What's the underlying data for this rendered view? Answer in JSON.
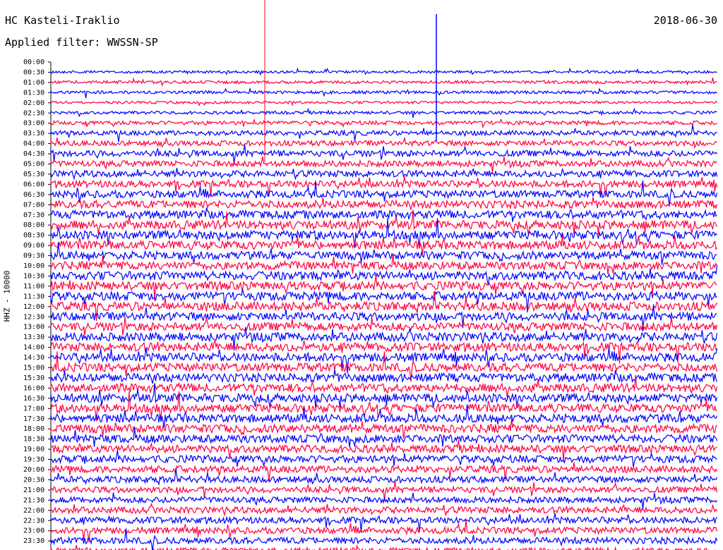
{
  "header": {
    "station": "HC Kasteli-Iraklio",
    "filter": "Applied filter: WWSSN-SP",
    "date": "2018-06-30"
  },
  "chart_data": {
    "type": "line",
    "ylabel": "HHZ - 10000",
    "colors": {
      "even": "#0000ff",
      "odd": "#ff0040",
      "marker": "#ff0000",
      "axis": "#000000"
    },
    "row_labels": [
      "00:00",
      "00:30",
      "01:00",
      "01:30",
      "02:00",
      "02:30",
      "03:00",
      "03:30",
      "04:00",
      "04:30",
      "05:00",
      "05:30",
      "06:00",
      "06:30",
      "07:00",
      "07:30",
      "08:00",
      "08:30",
      "09:00",
      "09:30",
      "10:00",
      "10:30",
      "11:00",
      "11:30",
      "12:00",
      "12:30",
      "13:00",
      "13:30",
      "14:00",
      "14:30",
      "15:00",
      "15:30",
      "16:00",
      "16:30",
      "17:00",
      "17:30",
      "18:00",
      "18:30",
      "19:00",
      "19:30",
      "20:00",
      "20:30",
      "21:00",
      "21:30",
      "22:00",
      "22:30",
      "23:00",
      "23:30"
    ],
    "trace_color_order": [
      "blue",
      "red"
    ],
    "noise_level": [
      0.3,
      0.35,
      0.35,
      0.3,
      0.35,
      0.45,
      0.55,
      0.6,
      0.7,
      0.7,
      0.75,
      0.8,
      0.85,
      0.9,
      0.95,
      1.0,
      1.0,
      1.0,
      0.95,
      0.95,
      1.0,
      1.0,
      1.0,
      1.0,
      0.95,
      0.95,
      1.0,
      1.0,
      1.0,
      1.0,
      1.0,
      1.0,
      1.0,
      1.0,
      1.0,
      1.0,
      0.95,
      0.9,
      0.85,
      0.8,
      0.75,
      0.7,
      0.7,
      0.75,
      0.75,
      0.75,
      0.75,
      0.7
    ]
  }
}
